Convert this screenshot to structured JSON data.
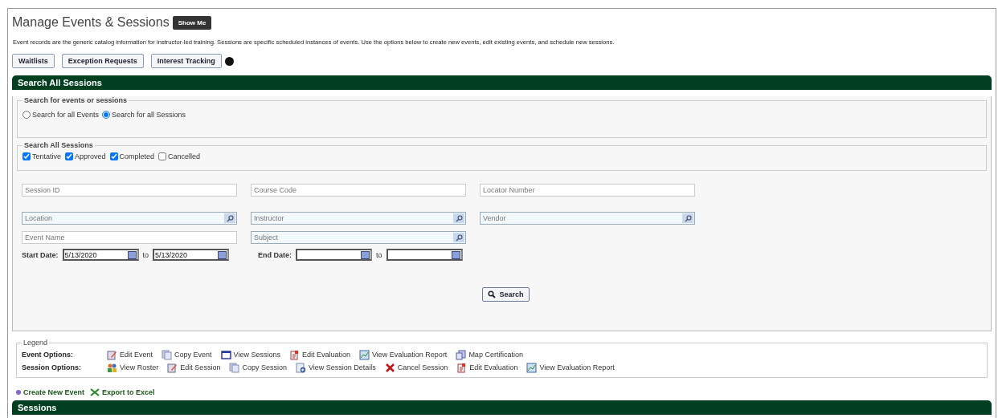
{
  "title": "Manage Events & Sessions",
  "show_me_button": "Show Me",
  "description": "Event records are the generic catalog information for instructor-led training. Sessions are specific scheduled instances of events. Use the options below to create new events, edit existing events, and schedule new sessions.",
  "buttons": [
    "Waitlists",
    "Exception Requests",
    "Interest Tracking"
  ],
  "search_panel": {
    "header": "Search All Sessions",
    "search_type": {
      "legend": "Search for events or sessions",
      "options": [
        {
          "label": "Search for all Events",
          "selected": false
        },
        {
          "label": "Search for all Sessions",
          "selected": true
        }
      ]
    },
    "statuses": {
      "legend": "Search All Sessions",
      "options": [
        {
          "label": "Tentative",
          "checked": true
        },
        {
          "label": "Approved",
          "checked": true
        },
        {
          "label": "Completed",
          "checked": true
        },
        {
          "label": "Cancelled",
          "checked": false
        }
      ]
    },
    "field_rows": [
      [
        {
          "kind": "text",
          "placeholder": "Session ID"
        },
        {
          "kind": "text",
          "placeholder": "Course Code"
        },
        {
          "kind": "text",
          "placeholder": "Locator Number"
        }
      ],
      [
        {
          "kind": "lookup",
          "placeholder": "Location"
        },
        {
          "kind": "lookup",
          "placeholder": "Instructor"
        },
        {
          "kind": "lookup",
          "placeholder": "Vendor"
        }
      ],
      [
        {
          "kind": "text",
          "placeholder": "Event Name"
        },
        {
          "kind": "lookup",
          "placeholder": "Subject"
        }
      ]
    ],
    "date_filters": [
      {
        "label": "Start Date:",
        "from": "5/13/2020",
        "separator": "to",
        "to": "5/13/2020"
      },
      {
        "label": "End Date:",
        "separator": "to"
      }
    ],
    "search_button": "Search"
  },
  "legend": {
    "title": "Legend",
    "rows": [
      {
        "label": "Event Options:",
        "items": [
          {
            "kind": "edit",
            "label": "Edit Event"
          },
          {
            "kind": "copy",
            "label": "Copy Event"
          },
          {
            "kind": "window",
            "label": "View Sessions"
          },
          {
            "kind": "evaluation",
            "label": "Edit Evaluation"
          },
          {
            "kind": "report",
            "label": "View Evaluation Report"
          },
          {
            "kind": "map",
            "label": "Map Certification"
          }
        ]
      },
      {
        "label": "Session Options:",
        "items": [
          {
            "kind": "roster",
            "label": "View Roster"
          },
          {
            "kind": "edit",
            "label": "Edit Session"
          },
          {
            "kind": "copy",
            "label": "Copy Session"
          },
          {
            "kind": "details",
            "label": "View Session Details"
          },
          {
            "kind": "cancel",
            "label": "Cancel Session"
          },
          {
            "kind": "evaluation",
            "label": "Edit Evaluation"
          },
          {
            "kind": "report",
            "label": "View Evaluation Report"
          }
        ]
      }
    ]
  },
  "links": [
    {
      "kind": "create",
      "label": "Create New Event"
    },
    {
      "kind": "excel",
      "label": "Export to Excel"
    }
  ],
  "sessions_header": "Sessions"
}
